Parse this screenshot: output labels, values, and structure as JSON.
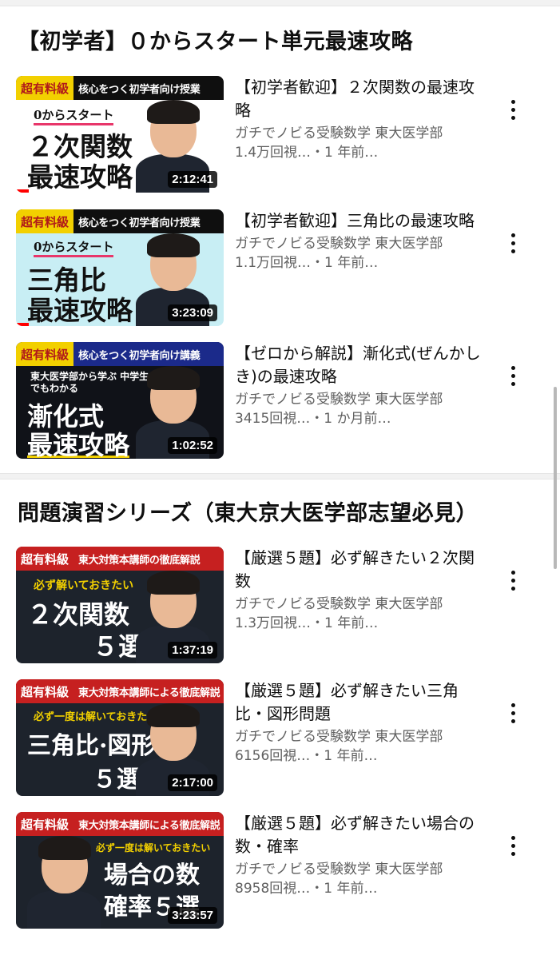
{
  "sections": [
    {
      "title": "【初学者】０からスタート単元最速攻略",
      "videos": [
        {
          "title": "【初学者歓迎】２次関数の最速攻略",
          "channel": "ガチでノビる受験数学 東大医学部",
          "stats": "1.4万回視…・1 年前…",
          "duration": "2:12:41",
          "thumb": {
            "tag": "超有料級",
            "banner": "核心をつく初学者向け授業",
            "small": "0からスタート",
            "line1": "２次関数",
            "line2": "最速攻略"
          }
        },
        {
          "title": "【初学者歓迎】三角比の最速攻略",
          "channel": "ガチでノビる受験数学 東大医学部",
          "stats": "1.1万回視…・1 年前…",
          "duration": "3:23:09",
          "thumb": {
            "tag": "超有料級",
            "banner": "核心をつく初学者向け授業",
            "small": "0からスタート",
            "line1": "三角比",
            "line2": "最速攻略"
          }
        },
        {
          "title": "【ゼロから解説】漸化式(ぜんかしき)の最速攻略",
          "channel": "ガチでノビる受験数学 東大医学部",
          "stats": "3415回視…・1 か月前…",
          "duration": "1:02:52",
          "thumb": {
            "tag": "超有料級",
            "banner": "核心をつく初学者向け講義",
            "small": "東大医学部から学ぶ 中学生でもわかる",
            "line1": "漸化式",
            "line2": "最速攻略"
          }
        }
      ]
    },
    {
      "title": "問題演習シリーズ（東大京大医学部志望必見）",
      "videos": [
        {
          "title": "【厳選５題】必ず解きたい２次関数",
          "channel": "ガチでノビる受験数学 東大医学部",
          "stats": "1.3万回視…・1 年前…",
          "duration": "1:37:19",
          "thumb": {
            "tag": "超有料級",
            "banner": "東大対策本講師の徹底解説",
            "small": "必ず解いておきたい",
            "line1": "２次関数",
            "line2": "５選"
          }
        },
        {
          "title": "【厳選５題】必ず解きたい三角比・図形問題",
          "channel": "ガチでノビる受験数学 東大医学部",
          "stats": "6156回視…・1 年前…",
          "duration": "2:17:00",
          "thumb": {
            "tag": "超有料級",
            "banner": "東大対策本講師による徹底解説",
            "small": "必ず一度は解いておきたい",
            "line1": "三角比·図形",
            "line2": "５選"
          }
        },
        {
          "title": "【厳選５題】必ず解きたい場合の数・確率",
          "channel": "ガチでノビる受験数学 東大医学部",
          "stats": "8958回視…・1 年前…",
          "duration": "3:23:57",
          "thumb": {
            "tag": "超有料級",
            "banner": "東大対策本講師による徹底解説",
            "small": "必ず一度は解いておきたい",
            "line1": "場合の数",
            "line2": "確率５選"
          }
        }
      ]
    }
  ],
  "icons": {
    "menu": "more-vert-icon"
  },
  "colors": {
    "progress": "#ff0000",
    "secondary_text": "#606060",
    "tag_yellow": "#f2d000",
    "tag_red": "#b11a1a"
  },
  "progress": [
    0.06,
    0.06,
    0,
    0,
    0,
    0
  ]
}
